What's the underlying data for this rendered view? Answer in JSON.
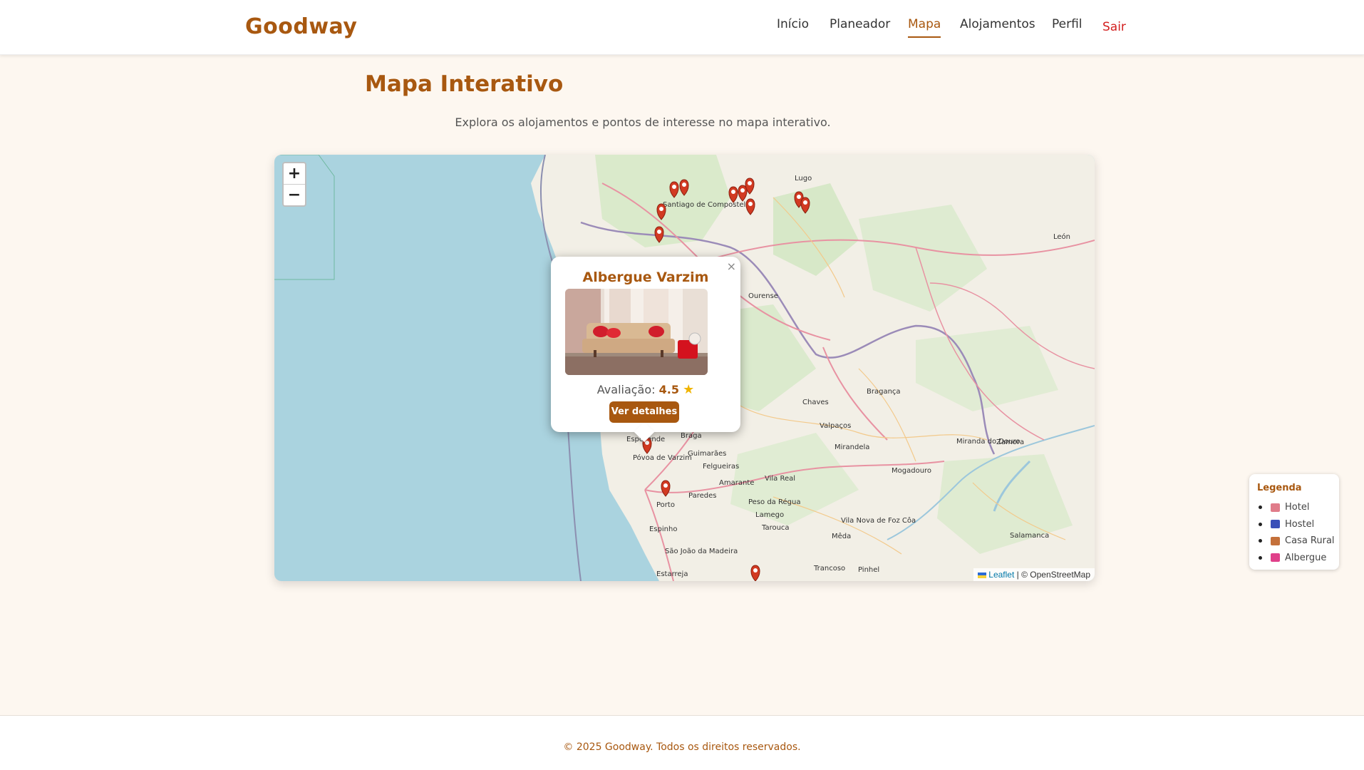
{
  "brand": "Goodway",
  "nav": {
    "items": [
      {
        "label": "Início"
      },
      {
        "label": "Planeador"
      },
      {
        "label": "Mapa"
      },
      {
        "label": "Alojamentos"
      },
      {
        "label": "Perfil"
      }
    ],
    "active": "Mapa",
    "logout": "Sair"
  },
  "page": {
    "title": "Mapa Interativo",
    "subtitle": "Explora os alojamentos e pontos de interesse no mapa interativo."
  },
  "map": {
    "zoom_in": "+",
    "zoom_out": "−",
    "attribution_link": "Leaflet",
    "attribution_text": "| © OpenStreetMap",
    "place_labels": [
      "Santiago de Compostela",
      "Lugo",
      "Ourense",
      "León",
      "Braga",
      "Guimarães",
      "Póvoa de Varzim",
      "Porto",
      "Espinho",
      "Chaves",
      "Bragança",
      "Zamora",
      "Mirandela",
      "Valpaços",
      "Vila Real",
      "Peso da Régua",
      "Lamego",
      "Amarante",
      "Felgueiras",
      "Paredes",
      "Mogadouro",
      "Miranda do Douro",
      "Salamanca",
      "Tarouca",
      "Mêda",
      "Trancoso",
      "Pinhel",
      "Vila Nova de Foz Côa",
      "São João da Madeira",
      "Estarreja",
      "Esposende"
    ],
    "popup": {
      "title": "Albergue Varzim",
      "rating_label": "Avaliação:",
      "rating_value": "4.5",
      "star": "★",
      "button": "Ver detalhes",
      "close": "×"
    }
  },
  "legend": {
    "title": "Legenda",
    "items": [
      {
        "label": "Hotel",
        "color": "#e07c8a"
      },
      {
        "label": "Hostel",
        "color": "#3a4fb8"
      },
      {
        "label": "Casa Rural",
        "color": "#c4703a"
      },
      {
        "label": "Albergue",
        "color": "#e0408a"
      }
    ]
  },
  "footer": "© 2025 Goodway. Todos os direitos reservados.",
  "colors": {
    "brand": "#a85810",
    "logout": "#d32020",
    "sea": "#aad3df",
    "land": "#f2efe6"
  }
}
